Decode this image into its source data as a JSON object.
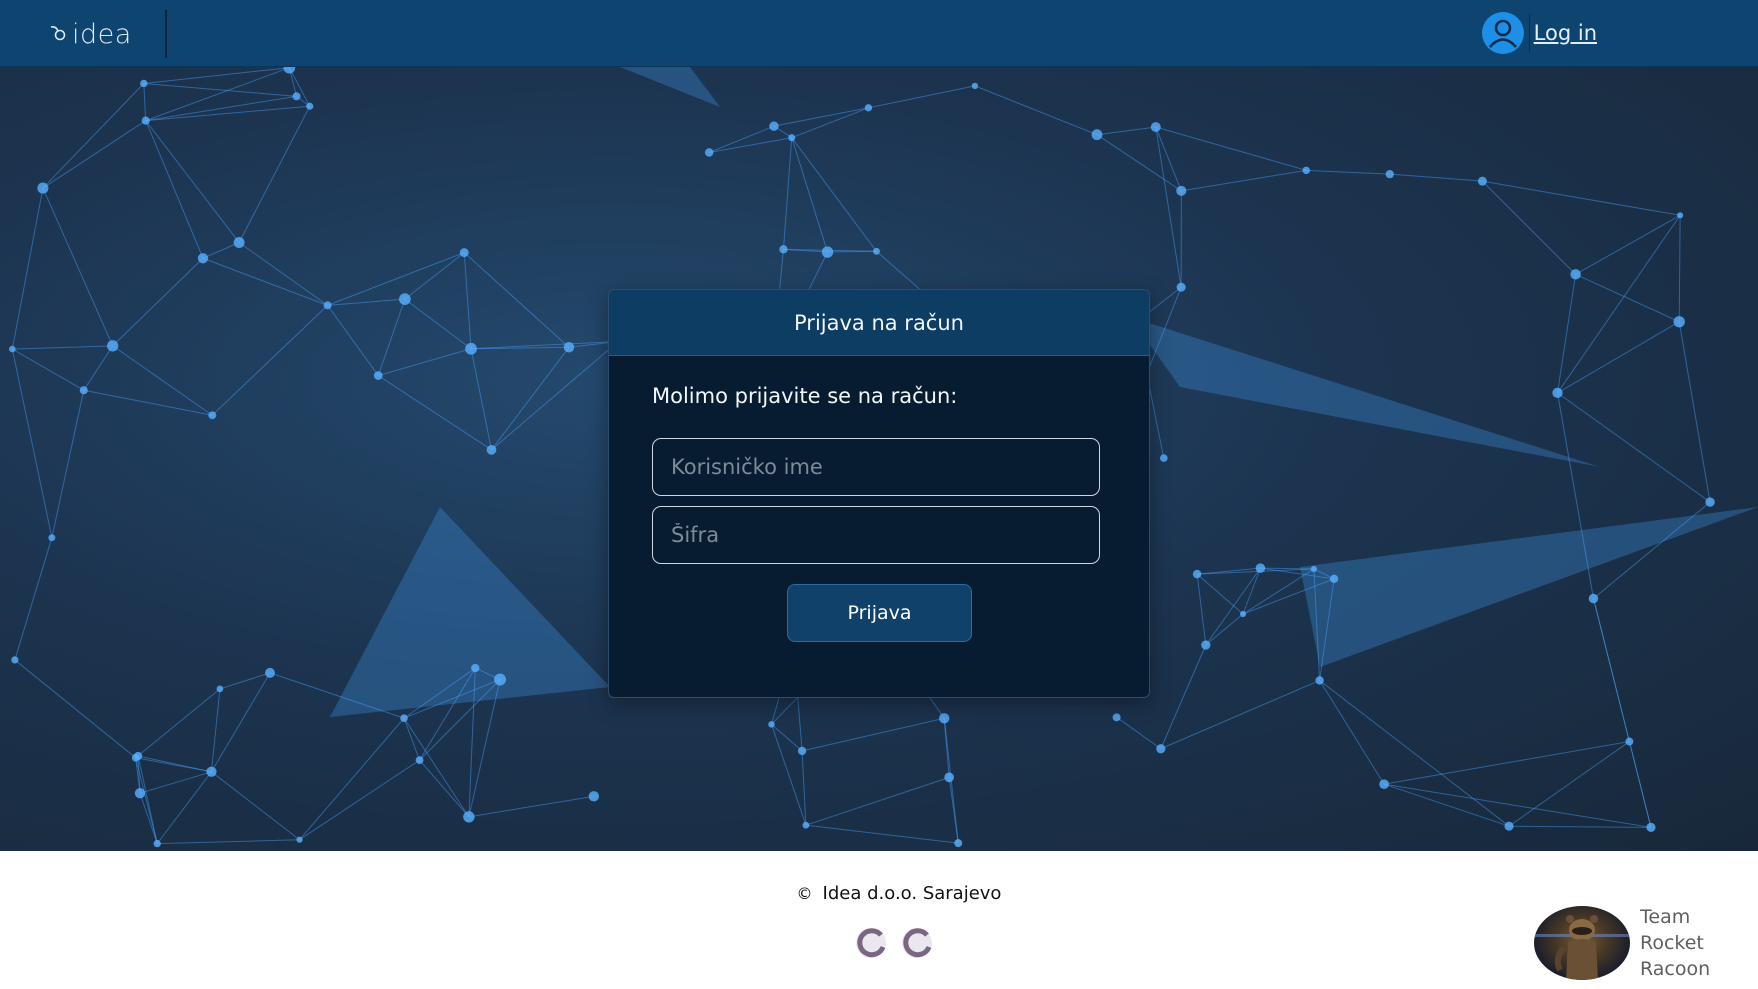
{
  "header": {
    "brand": "idea",
    "login_label": "Log in",
    "icons": {
      "brand_mark": "logo-mark-icon",
      "user": "user-icon"
    }
  },
  "login_card": {
    "title": "Prijava na račun",
    "prompt": "Molimo prijavite se na račun:",
    "username_placeholder": "Korisničko ime",
    "password_placeholder": "Šifra",
    "submit_label": "Prijava"
  },
  "footer": {
    "copyright_symbol": "©",
    "company": "Idea d.o.o. Sarajevo",
    "team_line1": "Team",
    "team_line2": "Rocket",
    "team_line3": "Racoon"
  },
  "colors": {
    "header_bg": "#0e4470",
    "card_bg": "#071c31",
    "card_header_bg": "#0e3d64",
    "accent": "#1e8fe6"
  }
}
